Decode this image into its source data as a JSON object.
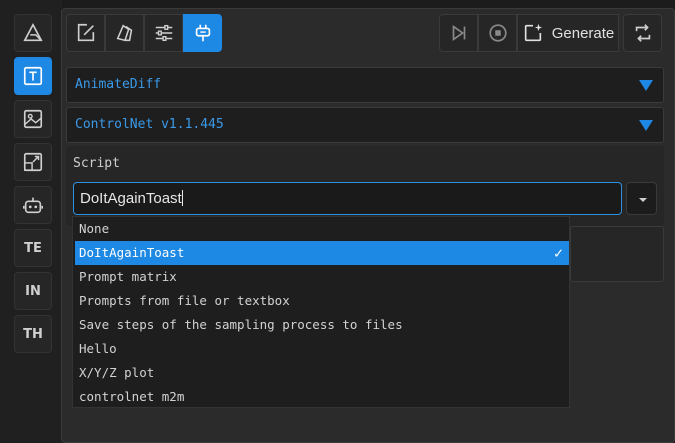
{
  "rail": {
    "items": [
      {
        "name": "triangle-logo-icon",
        "active": false
      },
      {
        "name": "text-tab-icon",
        "active": true
      },
      {
        "name": "image-tab-icon",
        "active": false
      },
      {
        "name": "resize-tab-icon",
        "active": false
      },
      {
        "name": "robot-tab-icon",
        "active": false
      }
    ],
    "text_items": [
      "TE",
      "IN",
      "TH"
    ]
  },
  "toolbar": {
    "generate_label": "Generate"
  },
  "accordions": {
    "animatediff": "AnimateDiff",
    "controlnet": "ControlNet v1.1.445"
  },
  "script": {
    "label": "Script",
    "value": "DoItAgainToast",
    "options": [
      "None",
      "DoItAgainToast",
      "Prompt matrix",
      "Prompts from file or textbox",
      "Save steps of the sampling process to files",
      "Hello",
      "X/Y/Z plot",
      "controlnet m2m"
    ],
    "selected_index": 1,
    "check_glyph": "✓"
  },
  "colors": {
    "accent": "#1e88e5",
    "background": "#1c1c1c",
    "panel": "#2b2b2b"
  }
}
